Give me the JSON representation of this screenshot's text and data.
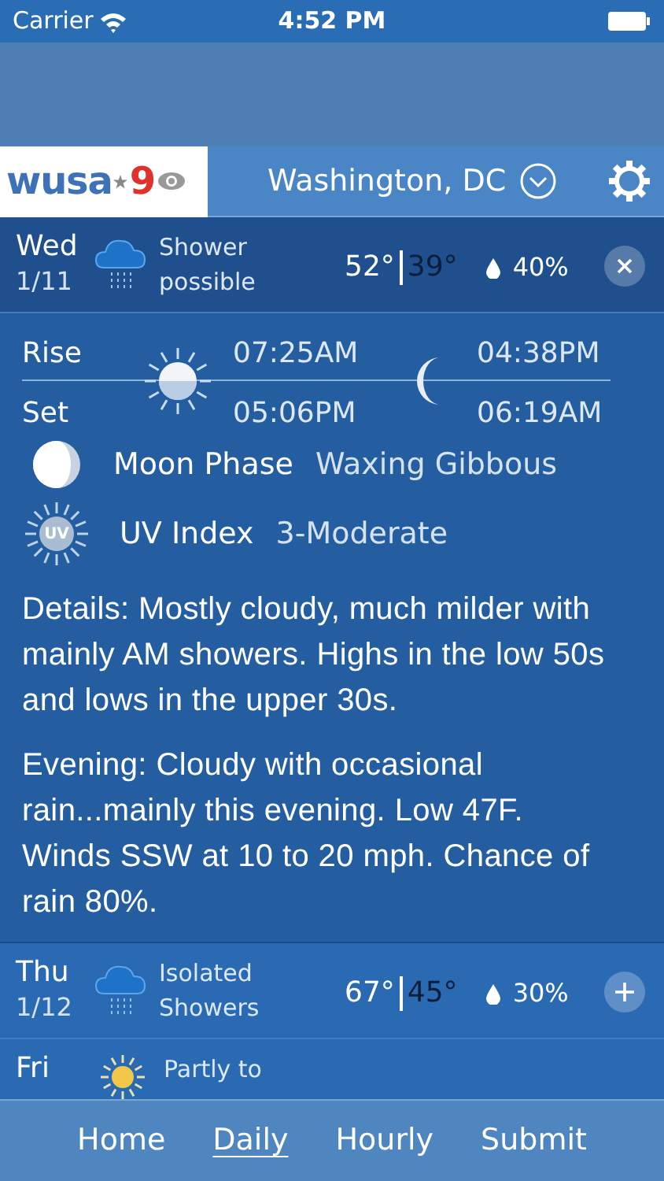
{
  "status_bar": {
    "carrier": "Carrier",
    "time": "4:52 PM"
  },
  "header": {
    "logo": {
      "name": "wusa",
      "number": "9"
    },
    "location": "Washington, DC"
  },
  "days": [
    {
      "day": "Wed",
      "date": "1/11",
      "condition": "Shower possible",
      "kind": "rain",
      "high": "52°",
      "low": "39°",
      "precip": "40%",
      "expanded": true
    },
    {
      "day": "Thu",
      "date": "1/12",
      "condition": "Isolated Showers",
      "kind": "rain",
      "high": "67°",
      "low": "45°",
      "precip": "30%",
      "expanded": false
    },
    {
      "day": "Fri",
      "condition": "Partly to",
      "kind": "sun",
      "expanded": false
    }
  ],
  "details": {
    "rise_label": "Rise",
    "set_label": "Set",
    "sunrise": "07:25AM",
    "sunset": "05:06PM",
    "moonrise": "04:38PM",
    "moonset": "06:19AM",
    "moon_phase_label": "Moon Phase",
    "moon_phase": "Waxing Gibbous",
    "uv_label": "UV Index",
    "uv_icon_text": "UV",
    "uv_value": "3-Moderate",
    "paragraphs": [
      "Details: Mostly cloudy, much milder with  mainly AM showers. Highs in the low 50s and lows in the upper 30s.",
      "Evening: Cloudy with occasional rain...mainly this evening. Low 47F. Winds SSW at 10 to 20 mph. Chance of rain 80%."
    ]
  },
  "tabs": [
    {
      "label": "Home",
      "selected": false
    },
    {
      "label": "Daily",
      "selected": true
    },
    {
      "label": "Hourly",
      "selected": false
    },
    {
      "label": "Submit",
      "selected": false
    }
  ]
}
